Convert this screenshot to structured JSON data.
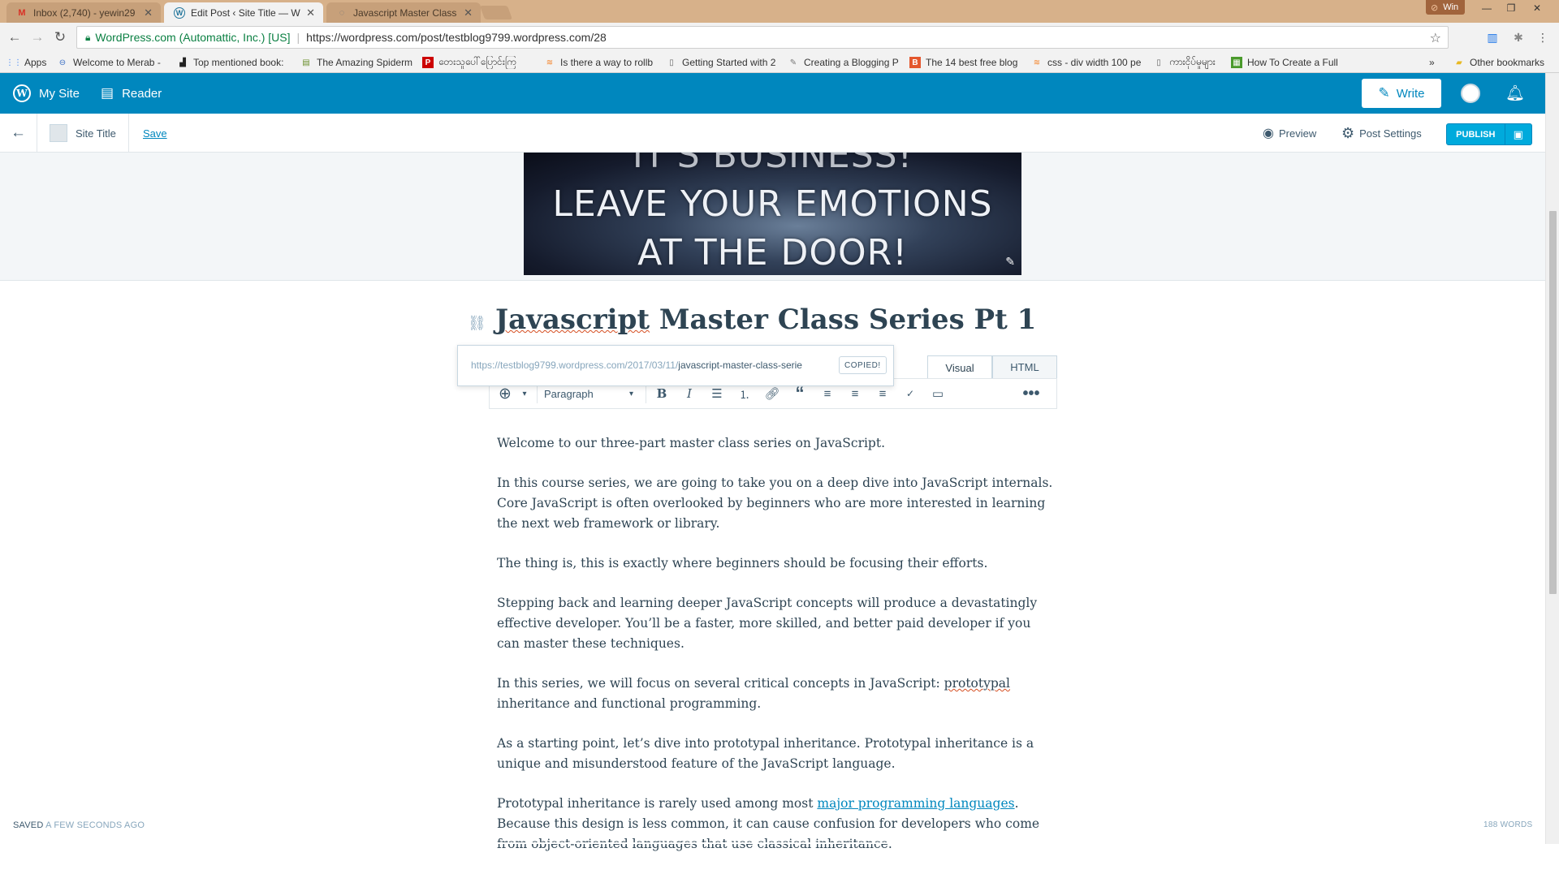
{
  "browser": {
    "tabs": [
      {
        "title": "Inbox (2,740) - yewin29",
        "favicon": "gmail-icon",
        "active": false
      },
      {
        "title": "Edit Post ‹ Site Title — W",
        "favicon": "wordpress-icon",
        "active": true
      },
      {
        "title": "Javascript Master Class S",
        "favicon": "loading-icon",
        "active": false
      }
    ],
    "profile_badge": "Win",
    "security_label": "WordPress.com (Automattic, Inc.) [US]",
    "url": "https://wordpress.com/post/testblog9799.wordpress.com/28",
    "bookmarks": [
      {
        "label": "Apps",
        "icon": "apps-grid-icon"
      },
      {
        "label": "Welcome to Merab -",
        "icon": "link-icon"
      },
      {
        "label": "Top mentioned book:",
        "icon": "chart-icon"
      },
      {
        "label": "The Amazing Spiderm",
        "icon": "page-icon"
      },
      {
        "label": "တေးသူပေါ်ပြောင်းကြ",
        "icon": "p-icon"
      },
      {
        "label": "Is there a way to rollb",
        "icon": "stack-icon"
      },
      {
        "label": "Getting Started with 2",
        "icon": "document-icon"
      },
      {
        "label": "Creating a Blogging P",
        "icon": "quill-icon"
      },
      {
        "label": "The 14 best free blog",
        "icon": "b-icon"
      },
      {
        "label": "css - div width 100 pe",
        "icon": "stack-icon"
      },
      {
        "label": "ကားငိုပ်မှုများ",
        "icon": "document-icon"
      },
      {
        "label": "How To Create a Full",
        "icon": "grid-icon"
      }
    ],
    "other_bookmarks": "Other bookmarks"
  },
  "masterbar": {
    "my_site": "My Site",
    "reader": "Reader",
    "write": "Write"
  },
  "groundbar": {
    "site_title": "Site Title",
    "save": "Save",
    "preview": "Preview",
    "post_settings": "Post Settings",
    "publish": "PUBLISH"
  },
  "featured_image": {
    "lines": [
      "IT'S BUSINESS!",
      "LEAVE YOUR EMOTIONS",
      "AT THE DOOR!"
    ]
  },
  "post": {
    "title_word1": "Javascript",
    "title_rest": " Master Class Series Pt 1",
    "permalink_base": "https://testblog9799.wordpress.com/2017/03/11/",
    "permalink_slug": "javascript-master-class-serie",
    "copied": "COPIED!"
  },
  "editor": {
    "tabs": {
      "visual": "Visual",
      "html": "HTML"
    },
    "format": "Paragraph"
  },
  "content": {
    "p1": "Welcome to our three-part master class series on JavaScript.",
    "p2": "In this course series, we are going to take you on a deep dive into JavaScript internals. Core JavaScript is often overlooked by beginners who are more interested in learning the next web framework or library.",
    "p3": "The thing is, this is exactly where beginners should be focusing their efforts.",
    "p4": "Stepping back and learning deeper JavaScript concepts will produce a devastatingly effective developer. You’ll be a faster, more skilled, and better paid developer if you can master these techniques.",
    "p5_before": "In this series, we will focus on several critical concepts in JavaScript: ",
    "p5_spell": "prototypal",
    "p5_after": " inheritance and functional programming.",
    "p6": "As a starting point, let’s dive into prototypal inheritance. Prototypal inheritance is a unique and misunderstood feature of the JavaScript language.",
    "p7_before": "Prototypal inheritance is rarely used among most ",
    "p7_link": "major programming languages",
    "p7_after": ". Because this design is less common, it can cause confusion for developers who come from object-oriented languages that use classical inheritance."
  },
  "status": {
    "saved_prefix": "SAVED",
    "saved_suffix": " A FEW SECONDS AGO",
    "word_count": "188 WORDS"
  }
}
